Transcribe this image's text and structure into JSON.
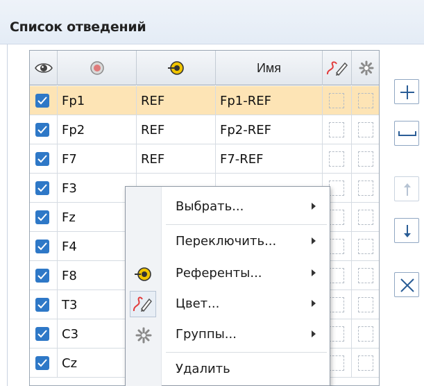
{
  "panel": {
    "title": "Список отведений"
  },
  "grid": {
    "headers": {
      "name": "Имя"
    },
    "rows": [
      {
        "electrode": "Fp1",
        "reference": "REF",
        "name": "Fp1-REF",
        "checked": true,
        "selected": true
      },
      {
        "electrode": "Fp2",
        "reference": "REF",
        "name": "Fp2-REF",
        "checked": true,
        "selected": false
      },
      {
        "electrode": "F7",
        "reference": "REF",
        "name": "F7-REF",
        "checked": true,
        "selected": false
      },
      {
        "electrode": "F3",
        "reference": "",
        "name": "",
        "checked": true,
        "selected": false
      },
      {
        "electrode": "Fz",
        "reference": "",
        "name": "",
        "checked": true,
        "selected": false
      },
      {
        "electrode": "F4",
        "reference": "",
        "name": "",
        "checked": true,
        "selected": false
      },
      {
        "electrode": "F8",
        "reference": "",
        "name": "",
        "checked": true,
        "selected": false
      },
      {
        "electrode": "T3",
        "reference": "",
        "name": "",
        "checked": true,
        "selected": false
      },
      {
        "electrode": "C3",
        "reference": "",
        "name": "",
        "checked": true,
        "selected": false
      },
      {
        "electrode": "Cz",
        "reference": "",
        "name": "",
        "checked": true,
        "selected": false
      }
    ]
  },
  "side_buttons": [
    {
      "icon": "plus-icon",
      "enabled": true
    },
    {
      "icon": "minus-icon",
      "enabled": true
    },
    {
      "icon": "arrow-up-icon",
      "enabled": false
    },
    {
      "icon": "arrow-down-icon",
      "enabled": true
    },
    {
      "icon": "close-icon",
      "enabled": true
    }
  ],
  "context_menu": {
    "items": [
      {
        "label": "Выбрать...",
        "submenu": true
      },
      {
        "label": "Переключить...",
        "submenu": true
      },
      {
        "label": "Референты...",
        "submenu": true,
        "icon": "reference-electrode-icon"
      },
      {
        "label": "Цвет...",
        "submenu": true,
        "icon": "color-pen-icon"
      },
      {
        "label": "Группы...",
        "submenu": true,
        "icon": "groups-asterisk-icon"
      },
      {
        "label": "Удалить",
        "submenu": false
      }
    ]
  },
  "colors": {
    "selected_row": "#fde4b5",
    "checkbox": "#2e78c7",
    "header_gradient_top": "#eef3f9",
    "button_border": "#8fa6c2"
  }
}
